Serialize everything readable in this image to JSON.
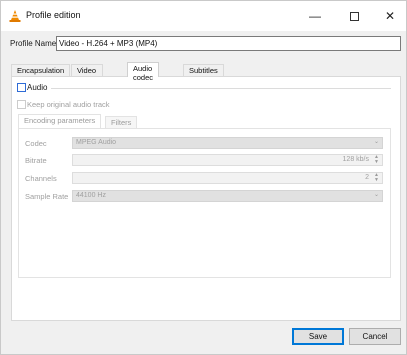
{
  "window": {
    "title": "Profile edition",
    "app_icon": "vlc-cone-icon"
  },
  "profile": {
    "label": "Profile Name",
    "value": "Video - H.264 + MP3 (MP4)"
  },
  "tabs": [
    {
      "label": "Encapsulation",
      "active": false
    },
    {
      "label": "Video codec",
      "active": false
    },
    {
      "label": "Audio codec",
      "active": true
    },
    {
      "label": "Subtitles",
      "active": false
    }
  ],
  "audio": {
    "checkbox_label": "Audio",
    "checked": false,
    "keep_original_label": "Keep original audio track",
    "keep_original_checked": false
  },
  "subtabs": [
    {
      "label": "Encoding parameters",
      "active": true
    },
    {
      "label": "Filters",
      "active": false
    }
  ],
  "encoding": {
    "codec": {
      "label": "Codec",
      "value": "MPEG Audio"
    },
    "bitrate": {
      "label": "Bitrate",
      "value": "128 kb/s"
    },
    "channels": {
      "label": "Channels",
      "value": "2"
    },
    "sample_rate": {
      "label": "Sample Rate",
      "value": "44100 Hz"
    }
  },
  "buttons": {
    "save": "Save",
    "cancel": "Cancel"
  },
  "colors": {
    "accent": "#0078d7",
    "checkbox_border": "#2e6bd6",
    "cone": "#f08a00"
  }
}
